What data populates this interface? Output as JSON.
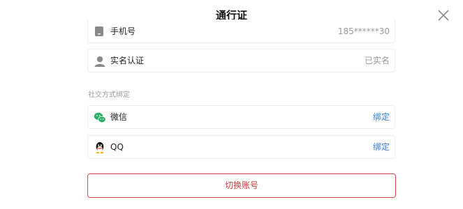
{
  "header": {
    "title": "通行证",
    "close_icon": "close-icon"
  },
  "account_rows": [
    {
      "icon": "phone-icon",
      "label": "手机号",
      "value": "185******30"
    },
    {
      "icon": "user-icon",
      "label": "实名认证",
      "value": "已实名"
    }
  ],
  "social": {
    "section_title": "社交方式绑定",
    "items": [
      {
        "icon": "wechat-icon",
        "label": "微信",
        "action": "绑定",
        "color": "#2aae67"
      },
      {
        "icon": "qq-icon",
        "label": "QQ",
        "action": "绑定",
        "color": "#000000"
      }
    ]
  },
  "footer": {
    "switch_label": "切换账号"
  },
  "colors": {
    "accent_link": "#3a7bd5",
    "danger": "#c8413f",
    "muted": "#999999"
  }
}
